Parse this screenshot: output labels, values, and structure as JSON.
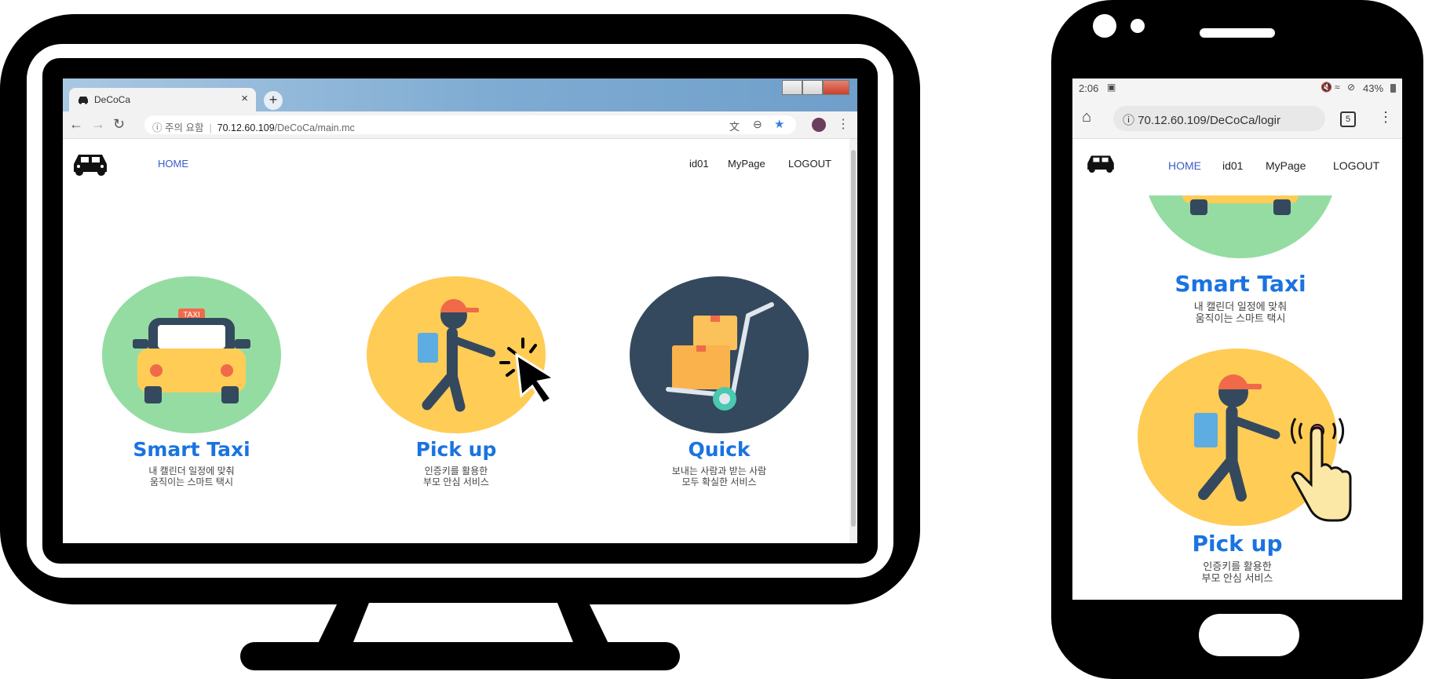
{
  "desktop": {
    "browser": {
      "tab_title": "DeCoCa",
      "tab_close": "×",
      "new_tab": "+",
      "security_label": "주의 요함",
      "url_host": "70.12.60.109",
      "url_path": "/DeCoCa/main.mc"
    },
    "nav": {
      "home": "HOME",
      "user_id": "id01",
      "mypage": "MyPage",
      "logout": "LOGOUT"
    },
    "services": [
      {
        "title": "Smart Taxi",
        "desc_line1": "내 캘린더 일정에 맞춰",
        "desc_line2": "움직이는 스마트 택시"
      },
      {
        "title": "Pick up",
        "desc_line1": "인증키를 활용한",
        "desc_line2": "부모 안심 서비스"
      },
      {
        "title": "Quick",
        "desc_line1": "보내는 사람과 받는 사람",
        "desc_line2": "모두 확실한 서비스"
      }
    ],
    "taxi_sign": "TAXI"
  },
  "mobile": {
    "status": {
      "time": "2:06",
      "battery": "43%"
    },
    "url": "70.12.60.109/DeCoCa/logir",
    "tab_count": "5",
    "nav": {
      "home": "HOME",
      "user_id": "id01",
      "mypage": "MyPage",
      "logout": "LOGOUT"
    },
    "services": [
      {
        "title": "Smart Taxi",
        "desc_line1": "내 캘린더 일정에 맞춰",
        "desc_line2": "움직이는 스마트 택시"
      },
      {
        "title": "Pick up",
        "desc_line1": "인증키를 활용한",
        "desc_line2": "부모 안심 서비스"
      }
    ]
  },
  "colors": {
    "taxi_circle": "#95dca3",
    "pickup_circle": "#ffcc55",
    "quick_circle": "#34495e",
    "title_blue": "#1a73e0",
    "home_link": "#3a5bc7"
  }
}
